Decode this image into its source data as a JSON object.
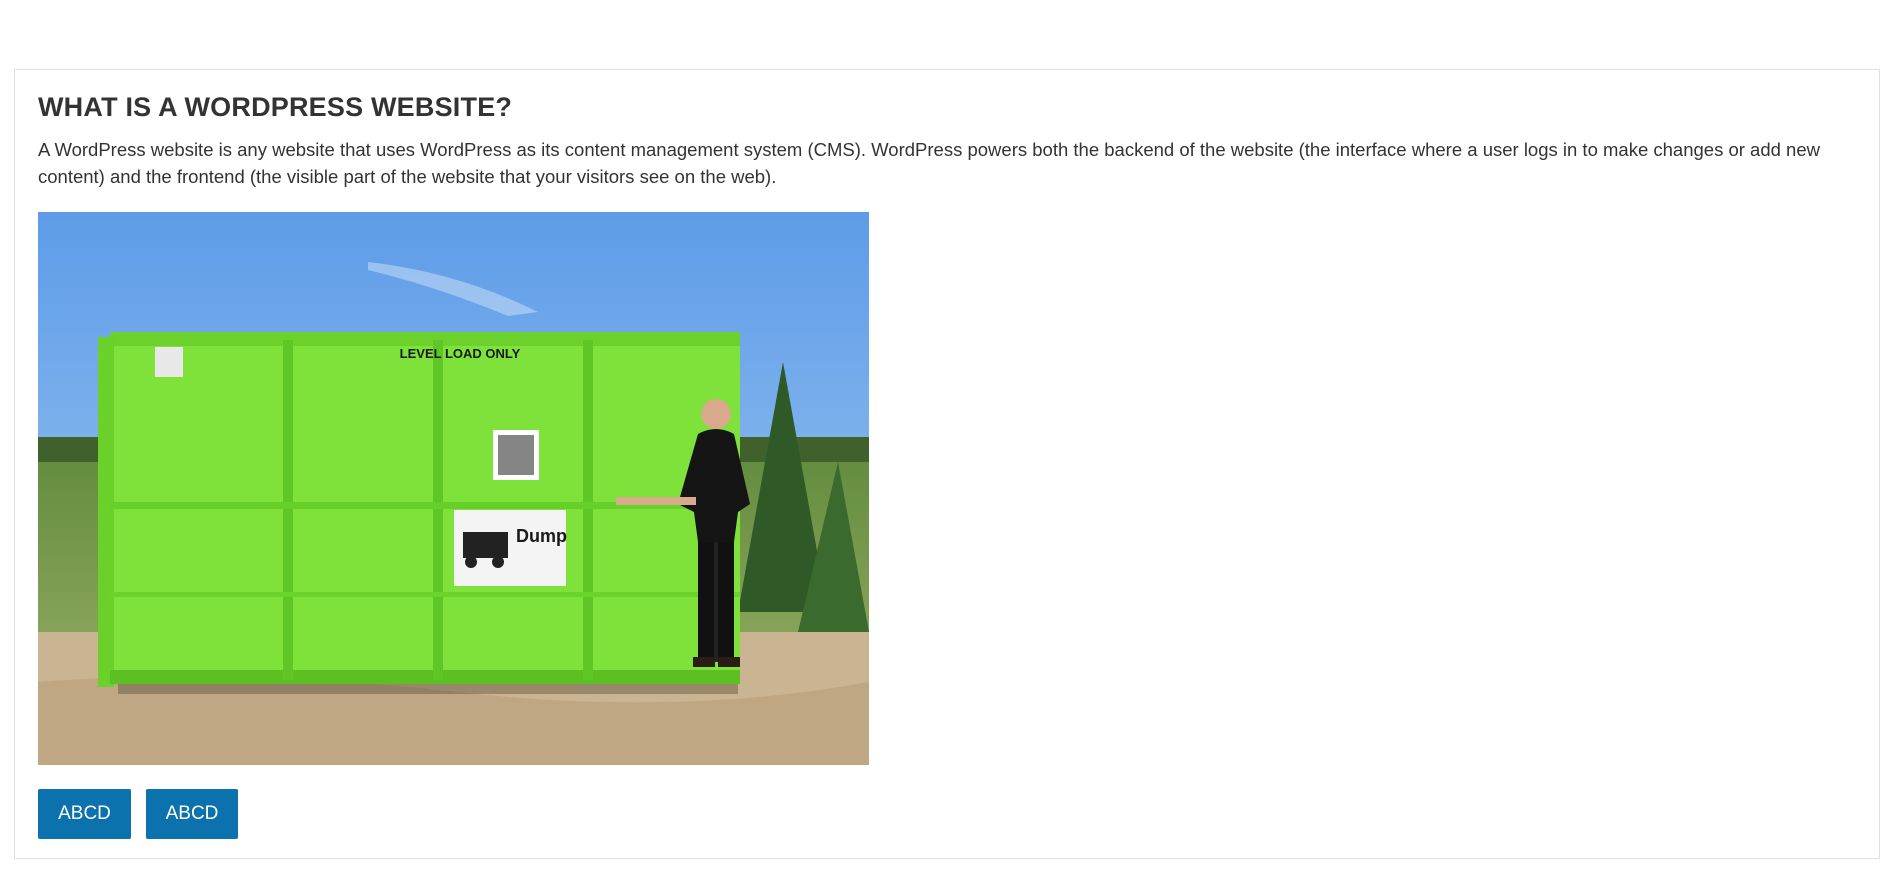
{
  "section": {
    "title": "WHAT IS A WORDPRESS WEBSITE?",
    "description": "A WordPress website is any website that uses WordPress as its content management system (CMS). WordPress powers both the backend of the website (the interface where a user logs in to make changes or add new content) and the frontend (the visible part of the website that your visitors see on the web)."
  },
  "image": {
    "container_text": "LEVEL LOAD ONLY",
    "sign_text": "Dump"
  },
  "buttons": [
    {
      "label": "ABCD"
    },
    {
      "label": "ABCD"
    }
  ],
  "colors": {
    "button_bg": "#0b72ad",
    "button_text": "#ffffff",
    "heading": "#333333",
    "dumpster": "#7ee23a"
  }
}
